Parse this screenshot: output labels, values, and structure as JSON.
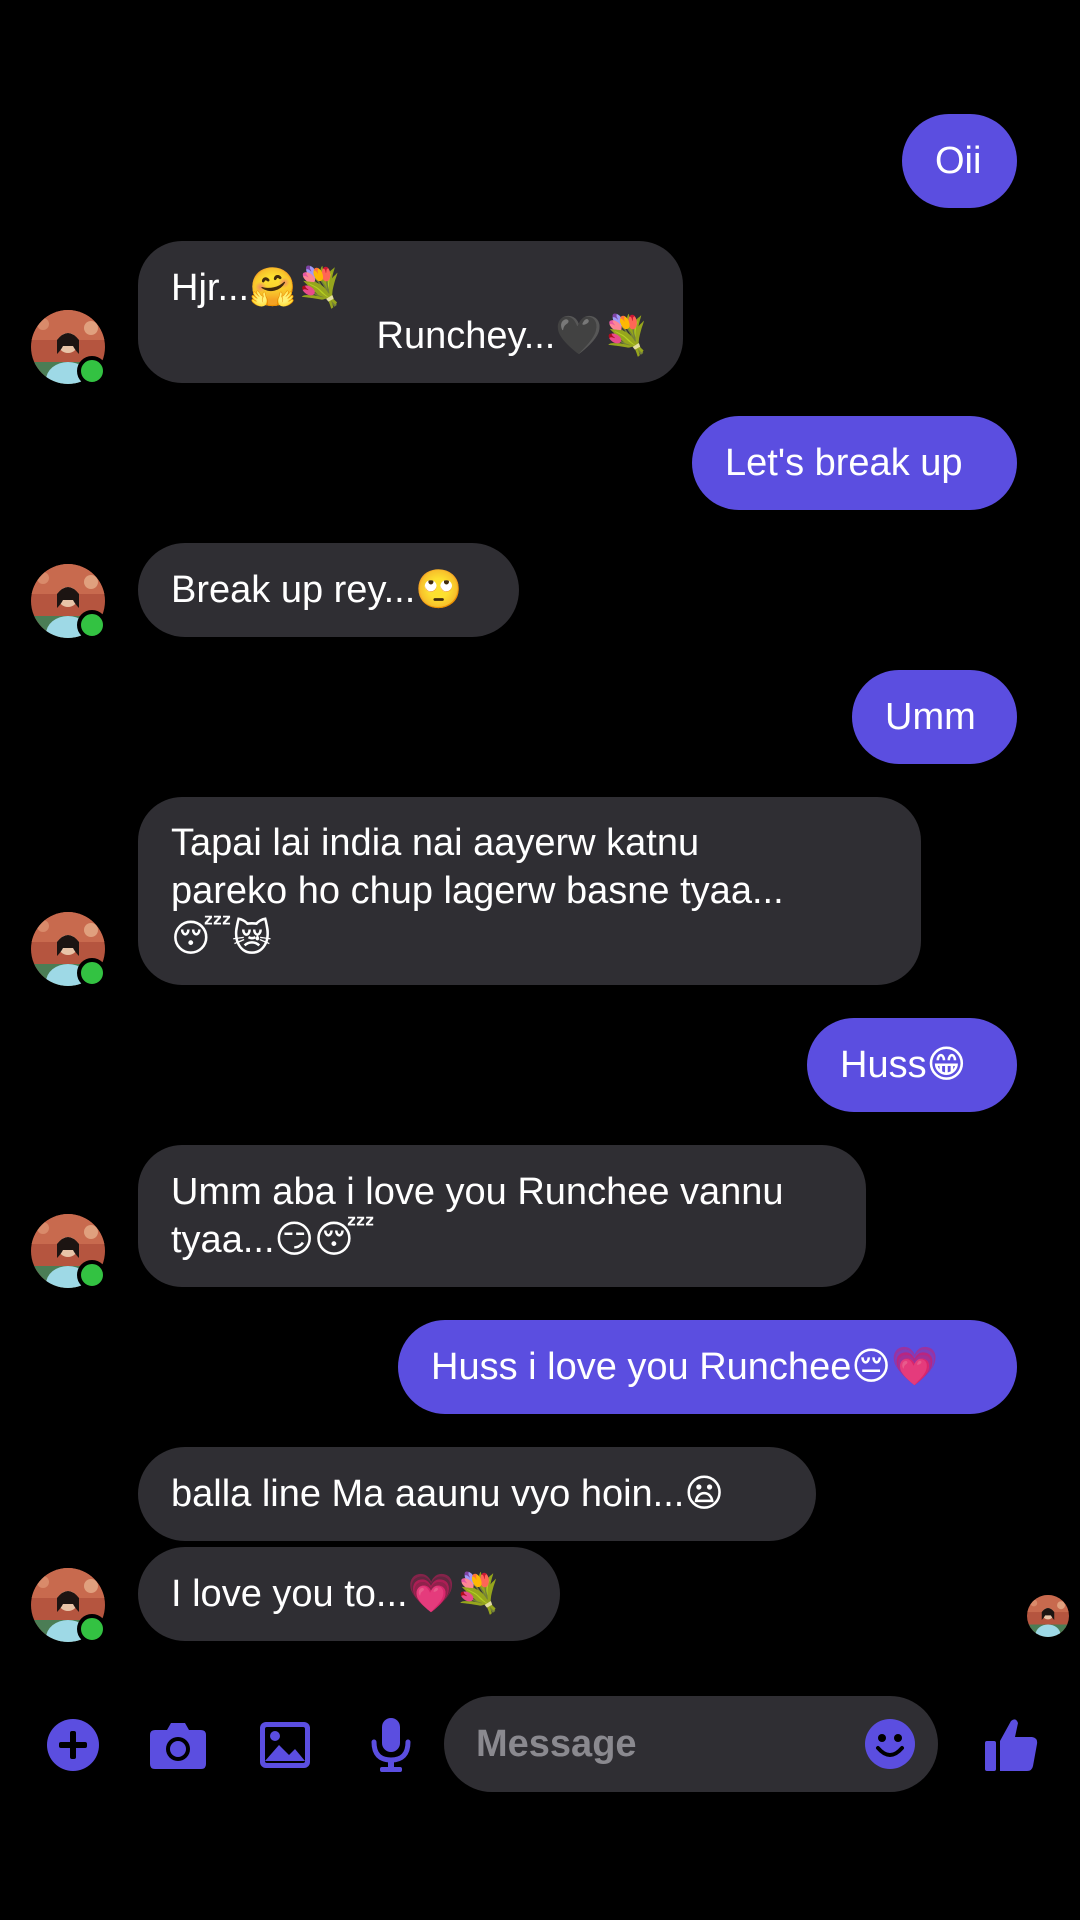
{
  "colors": {
    "background": "#000000",
    "outgoing_bubble": "#5b4ee0",
    "incoming_bubble": "#2f2e33",
    "accent_icon": "#5b4ee0",
    "online_dot": "#33c242",
    "placeholder": "#8a898f"
  },
  "messages": [
    {
      "direction": "out",
      "lines": [
        "Oii"
      ]
    },
    {
      "direction": "in",
      "lines": [
        "Hjr...🤗💐",
        "Runchey...🖤💐"
      ],
      "avatar": "contact-avatar"
    },
    {
      "direction": "out",
      "lines": [
        "Let's break up"
      ]
    },
    {
      "direction": "in",
      "lines": [
        "Break up rey...🙄"
      ],
      "avatar": "contact-avatar"
    },
    {
      "direction": "out",
      "lines": [
        "Umm"
      ]
    },
    {
      "direction": "in",
      "lines": [
        "Tapai lai india nai aayerw katnu",
        "pareko ho chup lagerw basne tyaa...",
        "😴😿"
      ],
      "avatar": "contact-avatar"
    },
    {
      "direction": "out",
      "lines": [
        "Huss😁"
      ]
    },
    {
      "direction": "in",
      "lines": [
        "Umm aba i love you Runchee vannu",
        "tyaa...😏😴"
      ],
      "avatar": "contact-avatar"
    },
    {
      "direction": "out",
      "lines": [
        "Huss i love you Runchee😔💗"
      ]
    },
    {
      "direction": "in",
      "lines": [
        "balla line Ma aaunu vyo hoin...😦"
      ]
    },
    {
      "direction": "in",
      "lines": [
        "I love you to...💗💐"
      ],
      "avatar": "contact-avatar"
    }
  ],
  "composer": {
    "icons": [
      "plus-icon",
      "camera-icon",
      "gallery-icon",
      "microphone-icon",
      "emoji-icon",
      "thumbs-up-icon"
    ],
    "placeholder": "Message",
    "value": ""
  }
}
